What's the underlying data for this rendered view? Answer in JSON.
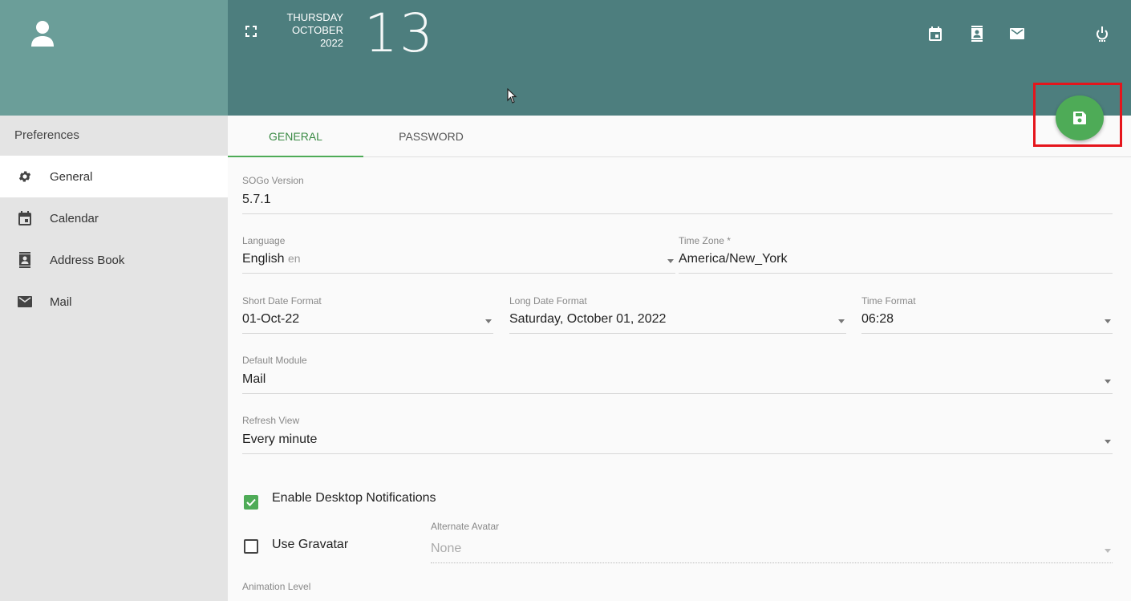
{
  "sidebar": {
    "title": "Preferences",
    "items": [
      {
        "label": "General",
        "icon": "gear-icon",
        "active": true
      },
      {
        "label": "Calendar",
        "icon": "calendar-icon"
      },
      {
        "label": "Address Book",
        "icon": "contacts-icon"
      },
      {
        "label": "Mail",
        "icon": "mail-icon"
      }
    ]
  },
  "topbar": {
    "weekday": "THURSDAY",
    "month": "OCTOBER",
    "year": "2022",
    "day": "13",
    "icons": [
      "calendar-icon",
      "contacts-icon",
      "mail-icon",
      "power-icon"
    ]
  },
  "tabs": [
    {
      "label": "GENERAL",
      "active": true
    },
    {
      "label": "PASSWORD",
      "active": false
    }
  ],
  "form": {
    "version": {
      "label": "SOGo Version",
      "value": "5.7.1"
    },
    "language": {
      "label": "Language",
      "value": "English",
      "hint": "en"
    },
    "timezone": {
      "label": "Time Zone *",
      "value": "America/New_York"
    },
    "short_date": {
      "label": "Short Date Format",
      "value": "01-Oct-22"
    },
    "long_date": {
      "label": "Long Date Format",
      "value": "Saturday, October 01, 2022"
    },
    "time_format": {
      "label": "Time Format",
      "value": "06:28"
    },
    "default_module": {
      "label": "Default Module",
      "value": "Mail"
    },
    "refresh_view": {
      "label": "Refresh View",
      "value": "Every minute"
    },
    "desktop_notifications": {
      "label": "Enable Desktop Notifications",
      "checked": true
    },
    "gravatar": {
      "label": "Use Gravatar",
      "checked": false
    },
    "alternate_avatar": {
      "label": "Alternate Avatar",
      "value": "None"
    },
    "animation_level": {
      "label": "Animation Level"
    }
  },
  "colors": {
    "sidebar_header": "#6b9e99",
    "topbar": "#4d7e7e",
    "accent": "#4eab57",
    "highlight": "#e5151c"
  }
}
